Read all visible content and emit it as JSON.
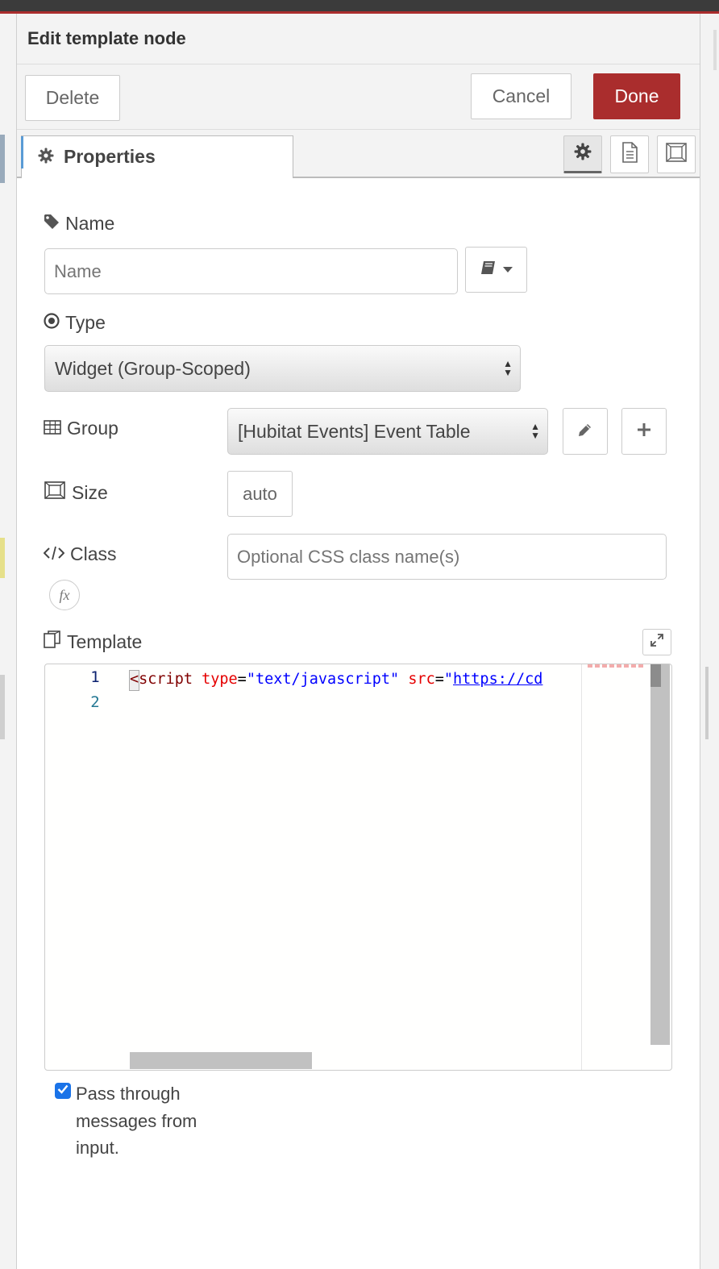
{
  "dialog": {
    "title": "Edit template node"
  },
  "toolbar": {
    "delete_label": "Delete",
    "cancel_label": "Cancel",
    "done_label": "Done"
  },
  "tabs": {
    "properties_label": "Properties"
  },
  "fields": {
    "name": {
      "label": "Name",
      "placeholder": "Name",
      "value": ""
    },
    "type": {
      "label": "Type",
      "selected": "Widget (Group-Scoped)"
    },
    "group": {
      "label": "Group",
      "selected": "[Hubitat Events] Event Table"
    },
    "size": {
      "label": "Size",
      "value": "auto"
    },
    "class": {
      "label": "Class",
      "placeholder": "Optional CSS class name(s)"
    },
    "template": {
      "label": "Template",
      "line_numbers": [
        "1",
        "2"
      ],
      "code": {
        "open": "<",
        "tag": "script",
        "attr1": "type",
        "eq": "=",
        "val1": "\"text/javascript\"",
        "attr2": "src",
        "val2_quote": "\"",
        "url": "https://cd"
      }
    }
  },
  "fx_label": "fx",
  "passthru": {
    "label": "Pass through messages from input.",
    "checked": true
  },
  "colors": {
    "accent": "#aa2d2d",
    "checkbox": "#1a73e8"
  },
  "icons": [
    "gear-icon",
    "document-icon",
    "appearance-icon",
    "tag-icon",
    "book-icon",
    "radio-icon",
    "table-icon",
    "size-icon",
    "code-icon",
    "clipboard-icon",
    "pencil-icon",
    "plus-icon",
    "expand-icon",
    "checkmark-icon"
  ]
}
